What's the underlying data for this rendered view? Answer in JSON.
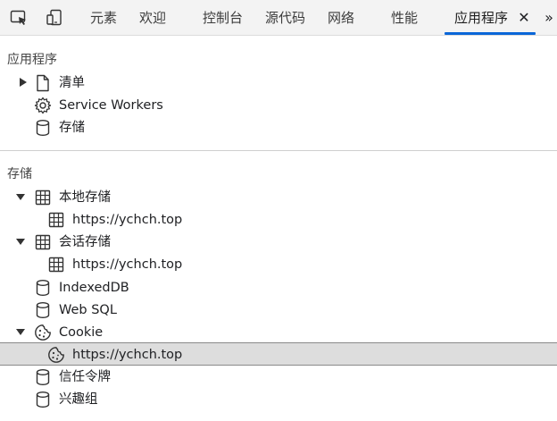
{
  "tabs": [
    {
      "label": "元素"
    },
    {
      "label": "欢迎"
    },
    {
      "label": "控制台"
    },
    {
      "label": "源代码"
    },
    {
      "label": "网络"
    },
    {
      "label": "性能"
    },
    {
      "label": "应用程序",
      "active": true
    }
  ],
  "application": {
    "header": "应用程序",
    "items": [
      {
        "label": "清单",
        "icon": "file-icon",
        "expand": "collapsed"
      },
      {
        "label": "Service Workers",
        "icon": "gear-icon"
      },
      {
        "label": "存储",
        "icon": "database-icon"
      }
    ]
  },
  "storage": {
    "header": "存储",
    "local_storage": {
      "label": "本地存储",
      "child": "https://ychch.top"
    },
    "session_storage": {
      "label": "会话存储",
      "child": "https://ychch.top"
    },
    "indexeddb": {
      "label": "IndexedDB"
    },
    "websql": {
      "label": "Web SQL"
    },
    "cookie": {
      "label": "Cookie",
      "child": "https://ychch.top"
    },
    "trust_tokens": {
      "label": "信任令牌"
    },
    "interest_groups": {
      "label": "兴趣组"
    }
  },
  "colors": {
    "accent": "#0a66d8",
    "selected_bg": "#dddddd"
  }
}
